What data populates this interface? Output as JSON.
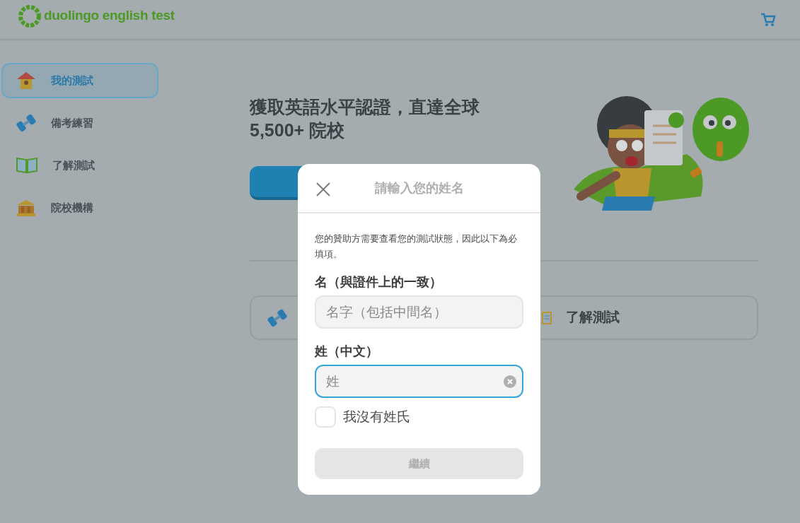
{
  "header": {
    "logo_text": "duolingo english test"
  },
  "sidebar": {
    "items": [
      {
        "label": "我的測試",
        "kind": "house",
        "selected": true
      },
      {
        "label": "備考練習",
        "kind": "dumbbell",
        "selected": false
      },
      {
        "label": "了解測試",
        "kind": "book",
        "selected": false
      },
      {
        "label": "院校機構",
        "kind": "building",
        "selected": false
      }
    ]
  },
  "main": {
    "heading_lines": [
      "獲取英語水平認證，直達全球",
      "5,500+ 院校"
    ],
    "cards": [
      {
        "kind": "dumbbell"
      },
      {
        "label": "了解測試",
        "kind": "notebook"
      }
    ]
  },
  "dialog": {
    "title": "請輸入您的姓名",
    "description": "您的贊助方需要查看您的測試狀態，因此以下為必填項。",
    "fields": [
      {
        "label": "名（與證件上的一致）",
        "placeholder": "名字（包括中間名）",
        "focused": false
      },
      {
        "label": "姓（中文）",
        "placeholder": "姓",
        "focused": true
      }
    ],
    "checkbox": {
      "label": "我沒有姓氏",
      "checked": false
    },
    "submit": {
      "label": "繼續",
      "disabled": true
    }
  }
}
